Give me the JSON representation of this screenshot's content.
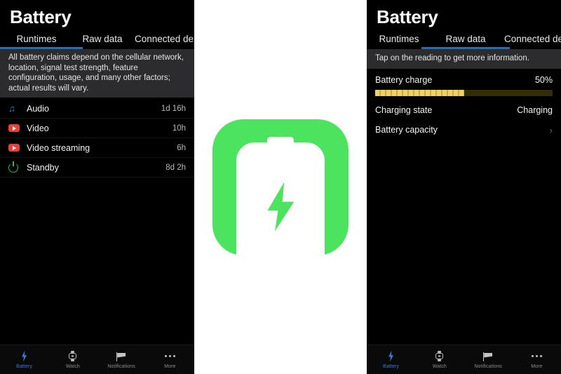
{
  "panels": {
    "left": {
      "title": "Battery",
      "tabs": [
        {
          "label": "Runtimes",
          "active": true
        },
        {
          "label": "Raw data",
          "active": false
        },
        {
          "label": "Connected de",
          "active": false
        }
      ],
      "banner": "All battery claims depend on the cellular network, location, signal test strength, feature configuration, usage, and many other factors; actual results will vary.",
      "rows": [
        {
          "icon": "music-note-icon",
          "label": "Audio",
          "value": "1d 16h"
        },
        {
          "icon": "video-play-icon",
          "label": "Video",
          "value": "10h"
        },
        {
          "icon": "video-play-icon",
          "label": "Video streaming",
          "value": "6h"
        },
        {
          "icon": "power-icon",
          "label": "Standby",
          "value": "8d 2h"
        }
      ]
    },
    "right": {
      "title": "Battery",
      "tabs": [
        {
          "label": "Runtimes",
          "active": false
        },
        {
          "label": "Raw data",
          "active": true
        },
        {
          "label": "Connected device",
          "active": false
        }
      ],
      "banner": "Tap on the reading to get more information.",
      "rows": [
        {
          "label": "Battery charge",
          "value": "50%",
          "meter": 50
        },
        {
          "label": "Charging state",
          "value": "Charging"
        },
        {
          "label": "Battery capacity",
          "chevron": "›"
        }
      ]
    }
  },
  "bottom_tabs": [
    {
      "icon": "lightning-bolt-icon",
      "label": "Battery",
      "active": true
    },
    {
      "icon": "watch-icon",
      "label": "Watch",
      "active": false
    },
    {
      "icon": "flag-icon",
      "label": "Notifications",
      "active": false
    },
    {
      "icon": "ellipsis-icon",
      "label": "More",
      "active": false
    }
  ],
  "app_icon": {
    "name": "battery-charging-app-icon",
    "background_color": "#4ce35f",
    "battery_color": "#ffffff",
    "bolt_color": "#4ce35f"
  },
  "colors": {
    "accent_blue": "#2c6ab4",
    "tab_active_blue": "#2f7fe0",
    "meter_fill": "#e7c757",
    "meter_track": "#332d06",
    "banner_bg": "#2c2c2e",
    "screen_bg": "#000000"
  },
  "glyphs": {
    "music_note": "♫",
    "ellipsis": "•••"
  }
}
